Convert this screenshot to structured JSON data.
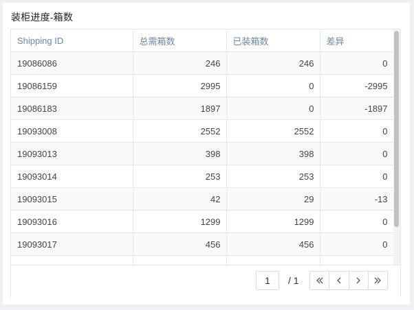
{
  "panel": {
    "title": "装柜进度-箱数"
  },
  "table": {
    "columns": [
      "Shipping ID",
      "总需箱数",
      "已装箱数",
      "差异"
    ],
    "rows": [
      [
        "19086086",
        "246",
        "246",
        "0"
      ],
      [
        "19086159",
        "2995",
        "0",
        "-2995"
      ],
      [
        "19086183",
        "1897",
        "0",
        "-1897"
      ],
      [
        "19093008",
        "2552",
        "2552",
        "0"
      ],
      [
        "19093013",
        "398",
        "398",
        "0"
      ],
      [
        "19093014",
        "253",
        "253",
        "0"
      ],
      [
        "19093015",
        "42",
        "29",
        "-13"
      ],
      [
        "19093016",
        "1299",
        "1299",
        "0"
      ],
      [
        "19093017",
        "456",
        "456",
        "0"
      ],
      [
        "",
        "",
        "",
        ""
      ]
    ]
  },
  "pagination": {
    "current_page": "1",
    "total_label": "/ 1",
    "buttons": [
      "first-page-icon",
      "prev-page-icon",
      "next-page-icon",
      "last-page-icon"
    ]
  },
  "colors": {
    "header_text": "#6e87a5",
    "border": "#e4e6eb",
    "stripe": "#fafafa"
  }
}
